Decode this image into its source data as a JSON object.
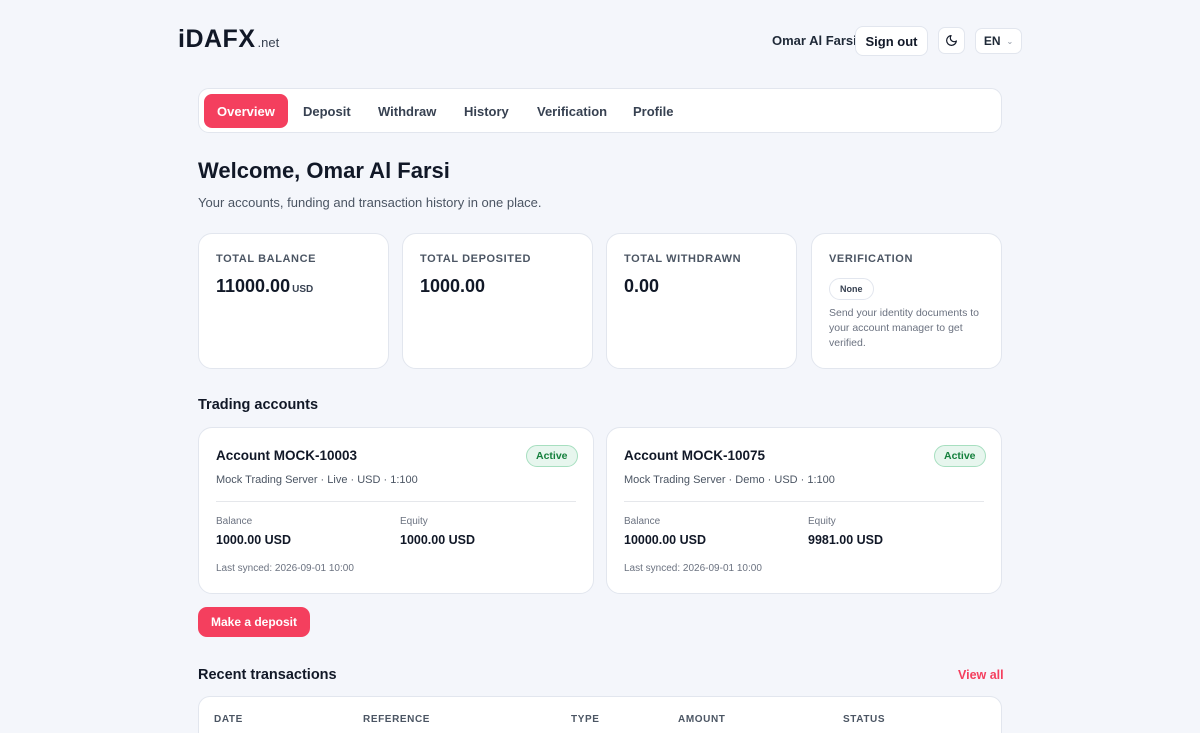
{
  "brand": {
    "name": "iDAFX",
    "suffix": ".net",
    "accent": "#f43f5e"
  },
  "header": {
    "user_name": "Omar Al Farsi",
    "sign_out_label": "Sign out",
    "theme_icon": "moon-icon",
    "language": "EN"
  },
  "tabs": [
    {
      "label": "Overview",
      "active": true
    },
    {
      "label": "Deposit",
      "active": false
    },
    {
      "label": "Withdraw",
      "active": false
    },
    {
      "label": "History",
      "active": false
    },
    {
      "label": "Verification",
      "active": false
    },
    {
      "label": "Profile",
      "active": false
    }
  ],
  "welcome": {
    "title": "Welcome, Omar Al Farsi",
    "subtitle": "Your accounts, funding and transaction history in one place."
  },
  "stats": {
    "total_balance": {
      "label": "TOTAL BALANCE",
      "value": "11000.00",
      "unit": "USD"
    },
    "total_deposited": {
      "label": "TOTAL DEPOSITED",
      "value": "1000.00"
    },
    "total_withdrawn": {
      "label": "TOTAL WITHDRAWN",
      "value": "0.00"
    },
    "verification": {
      "label": "VERIFICATION",
      "status": "None",
      "note": "Send your identity documents to your account manager to get verified."
    }
  },
  "trading_accounts": {
    "title": "Trading accounts",
    "accounts": [
      {
        "title": "Account MOCK-10003",
        "status": "Active",
        "meta": "Mock Trading Server · Live · USD · 1:100",
        "balance_label": "Balance",
        "balance": "1000.00 USD",
        "equity_label": "Equity",
        "equity": "1000.00 USD",
        "last_synced": "Last synced: 2026-09-01 10:00"
      },
      {
        "title": "Account MOCK-10075",
        "status": "Active",
        "meta": "Mock Trading Server · Demo · USD · 1:100",
        "balance_label": "Balance",
        "balance": "10000.00 USD",
        "equity_label": "Equity",
        "equity": "9981.00 USD",
        "last_synced": "Last synced: 2026-09-01 10:00"
      }
    ]
  },
  "deposit_button_label": "Make a deposit",
  "recent_transactions": {
    "title": "Recent transactions",
    "view_all_label": "View all",
    "columns": [
      "DATE",
      "REFERENCE",
      "TYPE",
      "AMOUNT",
      "STATUS"
    ]
  }
}
